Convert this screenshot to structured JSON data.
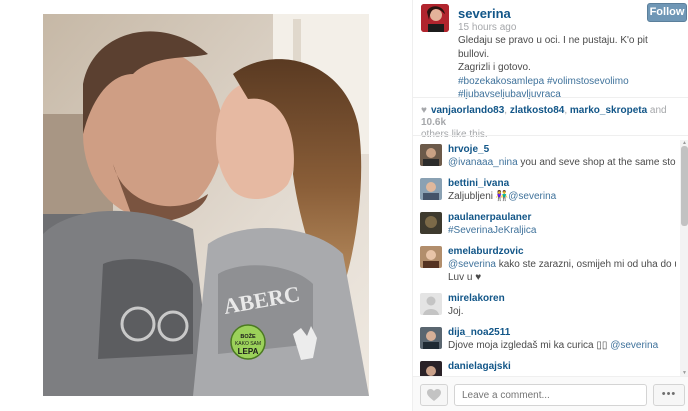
{
  "post": {
    "owner": "severina",
    "follow_label": "Follow",
    "time_ago": "15 hours ago",
    "caption_line1": "Gledaju se pravo u oci. I ne pustaju. K'o pit bullovi.",
    "caption_line2": "Zagrizli i gotovo.",
    "hashtags_line1": "#bozekakosamlepa #volimstosevolimo",
    "hashtags_line2": "#ljubavseljubavljuvraca",
    "badge_text": "BOŽE KAKO SAM LEPA"
  },
  "likes": {
    "user1": "vanjaorlando83",
    "user2": "zlatkosto84",
    "user3": "marko_skropeta",
    "and_label": " and ",
    "count": "10.6k",
    "suffix": "others like this."
  },
  "comments": [
    {
      "user": "hrvoje_5",
      "mention": "@ivanaaa_nina",
      "text": " you and seve shop at the same store..."
    },
    {
      "user": "bettini_ivana",
      "text": "Zaljubljeni 👫",
      "mention": "@severina"
    },
    {
      "user": "paulanerpaulaner",
      "mention": "#SeverinaJeKraljica"
    },
    {
      "user": "emelaburdzovic",
      "mention": "@severina",
      "text": " kako ste zarazni, osmijeh mi od uha do uha.",
      "text2": "Luv u ♥"
    },
    {
      "user": "mirelakoren",
      "text": "Joj."
    },
    {
      "user": "dija_noa2511",
      "text": "Djove moja izgledaš mi ka curica ▯▯ ",
      "mention": "@severina"
    },
    {
      "user": "danielagajski",
      "text": "♥♥♥"
    }
  ],
  "footer": {
    "comment_placeholder": "Leave a comment...",
    "more_label": "•••"
  },
  "icons": {
    "like": "heart-icon",
    "more": "ellipsis-icon"
  },
  "colors": {
    "link": "#125688",
    "hashtag": "#3f729b",
    "follow_button": "#6f97b6"
  }
}
